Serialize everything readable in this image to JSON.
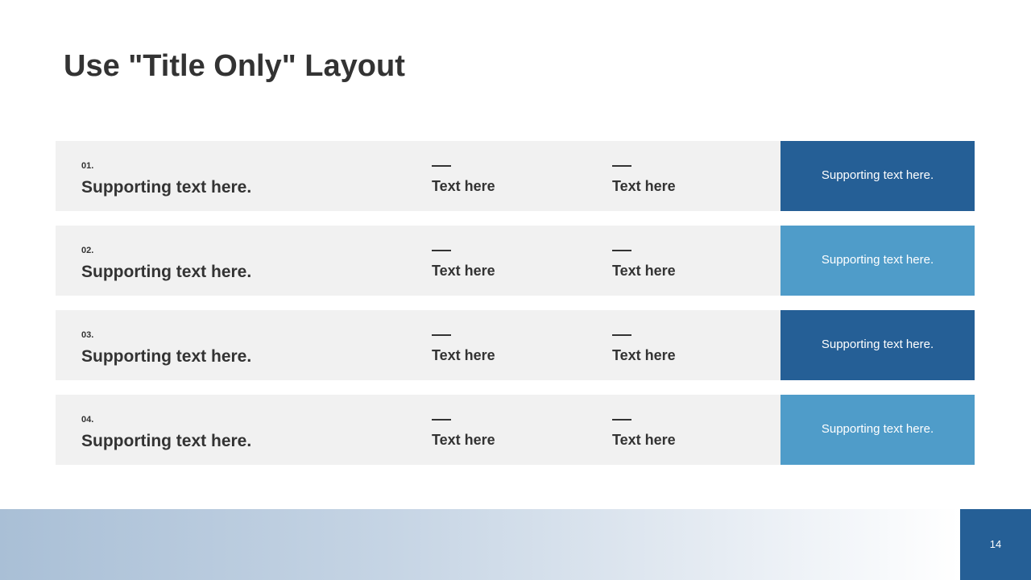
{
  "slide": {
    "title": "Use \"Title Only\" Layout",
    "page_number": "14"
  },
  "colors": {
    "dark_blue": "#255f96",
    "light_blue": "#4f9cc9",
    "row_background": "#f1f1f1",
    "text_dark": "#333333"
  },
  "rows": [
    {
      "number": "01.",
      "main_text": "Supporting text here.",
      "col1_text": "Text here",
      "col2_text": "Text here",
      "side_text": "Supporting text here.",
      "side_color": "#255f96"
    },
    {
      "number": "02.",
      "main_text": "Supporting text here.",
      "col1_text": "Text here",
      "col2_text": "Text here",
      "side_text": "Supporting text here.",
      "side_color": "#4f9cc9"
    },
    {
      "number": "03.",
      "main_text": "Supporting text here.",
      "col1_text": "Text here",
      "col2_text": "Text here",
      "side_text": "Supporting text here.",
      "side_color": "#255f96"
    },
    {
      "number": "04.",
      "main_text": "Supporting text here.",
      "col1_text": "Text here",
      "col2_text": "Text here",
      "side_text": "Supporting text here.",
      "side_color": "#4f9cc9"
    }
  ]
}
